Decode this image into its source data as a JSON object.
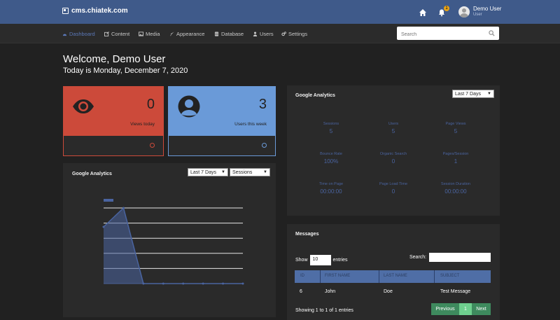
{
  "header": {
    "site": "cms.chiatek.com",
    "notification_count": "1",
    "user_name": "Demo User",
    "user_role": "User"
  },
  "nav": [
    {
      "label": "Dashboard",
      "icon": "dashboard-icon"
    },
    {
      "label": "Content",
      "icon": "edit-icon"
    },
    {
      "label": "Media",
      "icon": "image-icon"
    },
    {
      "label": "Appearance",
      "icon": "brush-icon"
    },
    {
      "label": "Database",
      "icon": "database-icon"
    },
    {
      "label": "Users",
      "icon": "user-icon"
    },
    {
      "label": "Settings",
      "icon": "gears-icon"
    }
  ],
  "search": {
    "placeholder": "Search"
  },
  "welcome": {
    "title": "Welcome, Demo User",
    "date": "Today is Monday, December 7, 2020"
  },
  "cards": {
    "views": {
      "value": "0",
      "label": "Views today",
      "color": "#cc4a3a"
    },
    "users": {
      "value": "3",
      "label": "Users this week",
      "color": "#6a9ad8"
    }
  },
  "ga_chart": {
    "title": "Google Analytics",
    "range": "Last 7 Days",
    "metric": "Sessions"
  },
  "ga_stats": {
    "title": "Google Analytics",
    "range": "Last 7 Days",
    "stats": [
      {
        "label": "Sessions",
        "value": "5"
      },
      {
        "label": "Users",
        "value": "5"
      },
      {
        "label": "Page Views",
        "value": "5"
      },
      {
        "label": "Bounce Rate",
        "value": "100%"
      },
      {
        "label": "Organic Search",
        "value": "0"
      },
      {
        "label": "Pages/Session",
        "value": "1"
      },
      {
        "label": "Time on Page",
        "value": "00:00:00"
      },
      {
        "label": "Page Load Time",
        "value": "0"
      },
      {
        "label": "Session Duration",
        "value": "00:00:00"
      }
    ]
  },
  "messages": {
    "title": "Messages",
    "show": "Show",
    "entries_value": "10",
    "entries": "entries",
    "search_label": "Search:",
    "columns": [
      "ID",
      "FIRST NAME",
      "LAST NAME",
      "SUBJECT"
    ],
    "rows": [
      {
        "id": "6",
        "first": "John",
        "last": "Doe",
        "subject": "Test Message"
      }
    ],
    "showing": "Showing 1 to 1 of 1 entries",
    "prev": "Previous",
    "page": "1",
    "next": "Next"
  },
  "chart_data": {
    "type": "area",
    "series": [
      {
        "values": [
          3,
          4,
          0,
          0,
          0,
          0,
          0,
          0
        ]
      }
    ],
    "ylim": [
      0,
      4
    ],
    "grid": true
  }
}
